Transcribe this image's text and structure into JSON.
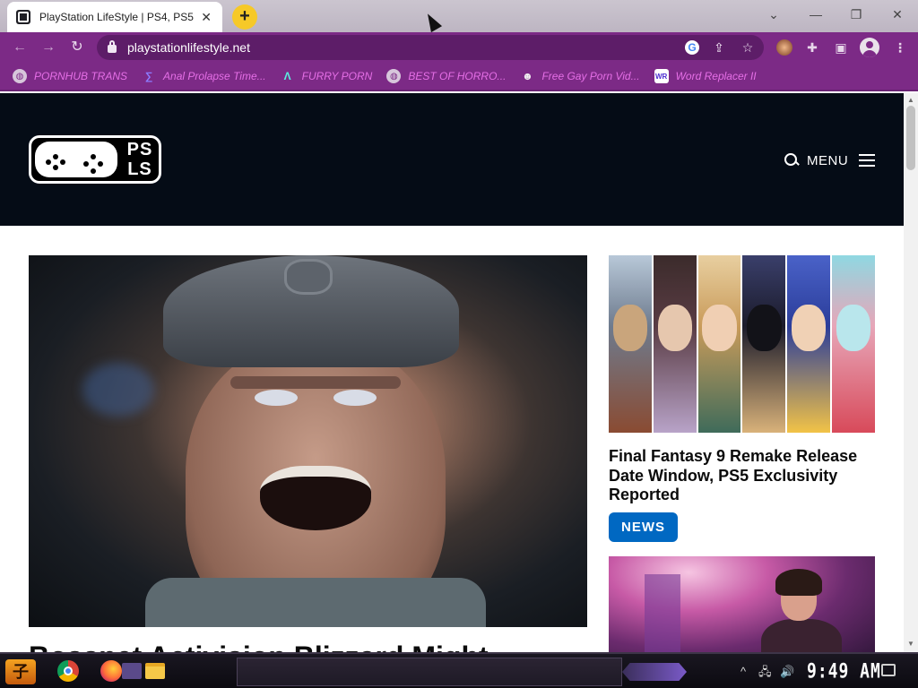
{
  "browser": {
    "tab": {
      "title": "PlayStation LifeStyle | PS4, PS5"
    },
    "new_tab_symbol": "+",
    "window_controls": {
      "dropdown": "⌄",
      "minimize": "—",
      "restore": "❐",
      "close": "✕"
    },
    "nav": {
      "back": "←",
      "forward": "→",
      "reload": "↻"
    },
    "address_bar": {
      "url": "playstationlifestyle.net"
    },
    "omnibox_icons": [
      "google-icon",
      "share-icon",
      "star-icon"
    ],
    "toolbar_icons": [
      "extension-avatar-icon",
      "puzzle-icon",
      "sidepanel-icon",
      "profile-icon",
      "kebab-menu-icon"
    ],
    "bookmarks": [
      {
        "label": "PORNHUB TRANS",
        "icon": "globe-icon"
      },
      {
        "label": "Anal Prolapse Time...",
        "icon": "purple-logo-icon"
      },
      {
        "label": "FURRY PORN",
        "icon": "lambda-icon"
      },
      {
        "label": "BEST OF HORRO...",
        "icon": "globe-icon"
      },
      {
        "label": "Free Gay Porn Vid...",
        "icon": "mascot-icon"
      },
      {
        "label": "Word Replacer II",
        "icon": "wr-icon"
      }
    ]
  },
  "site": {
    "logo_text": "PS LS",
    "menu_label": "MENU",
    "hero": {
      "headline_partial": "Bossnet Activision Blizzard Might"
    },
    "sidebar": {
      "articles": [
        {
          "title": "Final Fantasy 9 Remake Release Date Window, PS5 Exclusivity Reported",
          "category": "NEWS"
        }
      ]
    }
  },
  "taskbar": {
    "start_label": "子",
    "apps": [
      "chrome-icon",
      "firefox-icon",
      "file-explorer-icon"
    ],
    "tray": {
      "chevron": "^",
      "network": "🖧",
      "volume": "🔊"
    },
    "clock": "9:49 AM"
  },
  "colors": {
    "browser_accent": "#7c2a86",
    "bookmark_text": "#e56fe6",
    "site_header": "#050c16",
    "badge_blue": "#0068c2",
    "new_tab": "#f6c928"
  }
}
